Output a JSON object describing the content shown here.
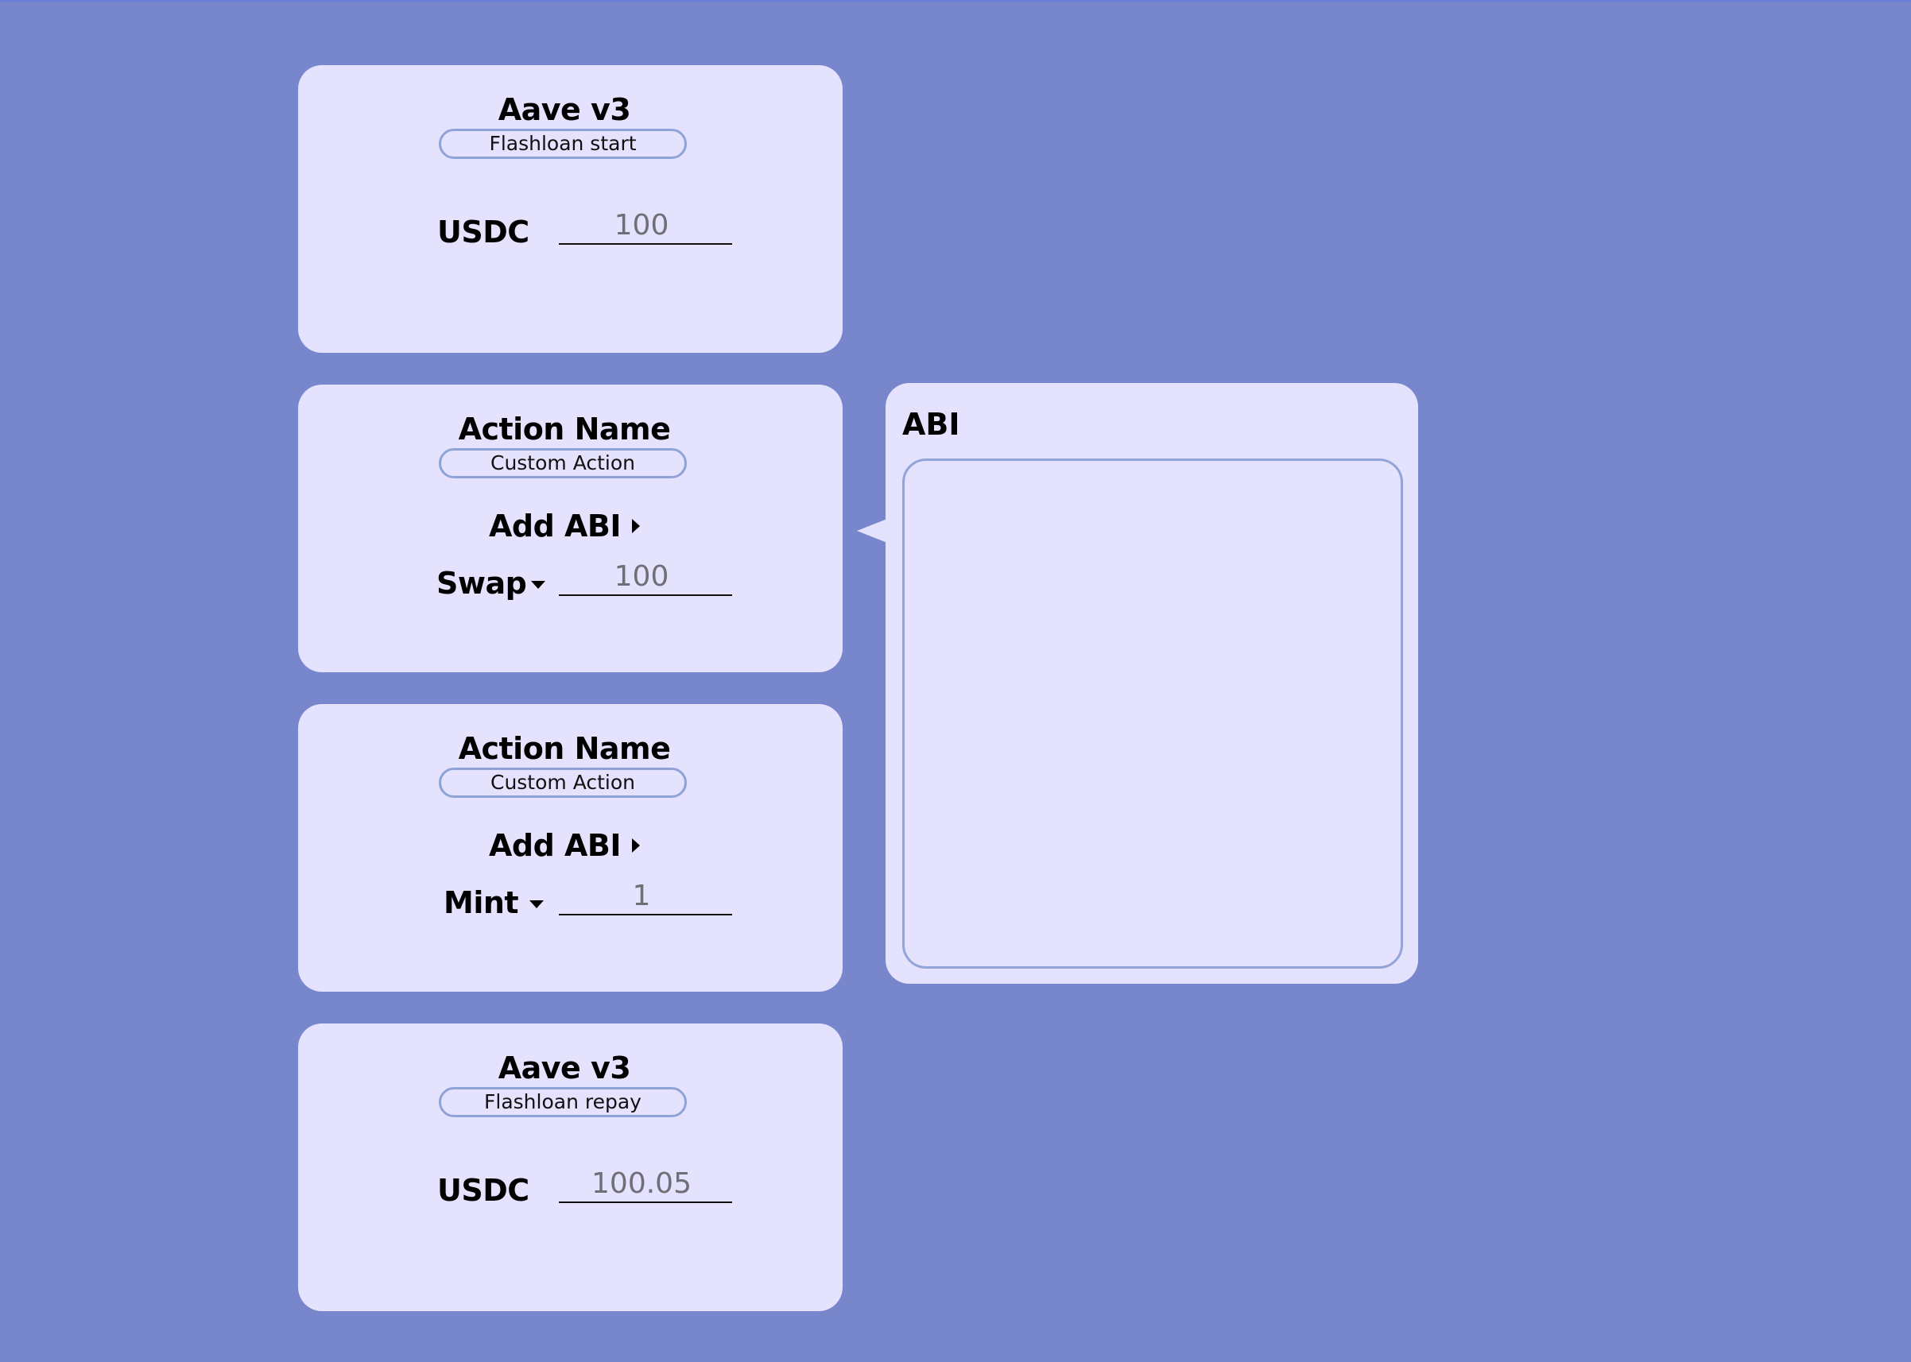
{
  "colors": {
    "background": "#7886cc",
    "card": "#e4e2fd",
    "pill_border": "#8fa2d8",
    "value_text": "#6f6f78"
  },
  "cards": [
    {
      "title": "Aave v3",
      "tag": "Flashloan start",
      "row_label": "USDC",
      "value": "100"
    },
    {
      "title": "Action Name",
      "tag": "Custom Action",
      "add_abi_label": "Add ABI",
      "row_label": "Swap",
      "value": "100"
    },
    {
      "title": "Action Name",
      "tag": "Custom Action",
      "add_abi_label": "Add ABI",
      "row_label": "Mint",
      "value": "1"
    },
    {
      "title": "Aave v3",
      "tag": "Flashloan repay",
      "row_label": "USDC",
      "value": "100.05"
    }
  ],
  "abi_panel": {
    "title": "ABI",
    "content": ""
  },
  "icons": {
    "add_abi": "triangle-right-icon",
    "dropdown": "triangle-down-icon"
  }
}
